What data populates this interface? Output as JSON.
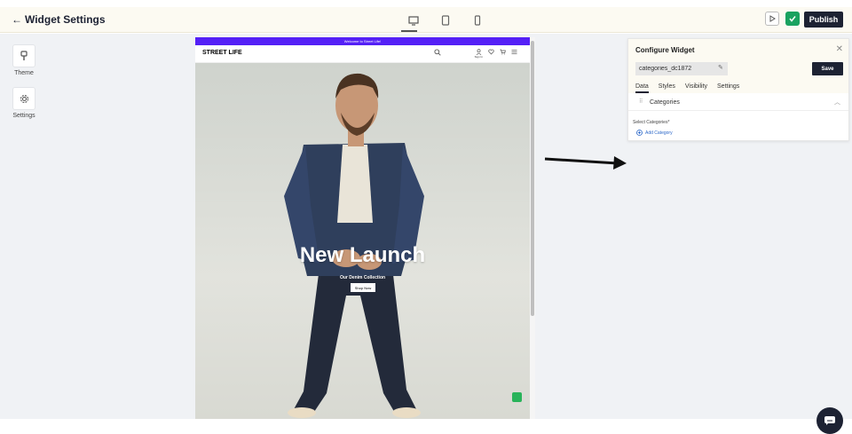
{
  "header": {
    "back_icon": "arrow-left-icon",
    "title": "Widget Settings",
    "devices": [
      {
        "name": "desktop",
        "icon": "desktop-icon",
        "active": true
      },
      {
        "name": "tablet",
        "icon": "tablet-icon",
        "active": false
      },
      {
        "name": "mobile",
        "icon": "mobile-icon",
        "active": false
      }
    ],
    "publish_label": "Publish",
    "publish_color": "#1d2233"
  },
  "sidebar": {
    "items": [
      {
        "label": "Theme",
        "icon": "brush-icon"
      },
      {
        "label": "Settings",
        "icon": "gear-icon"
      }
    ]
  },
  "preview": {
    "announcement": "Welcome to Street Life!",
    "announcement_color": "#5420f6",
    "logo": "STREET LIFE",
    "sign_in": "Sign In",
    "hero_title": "New Launch",
    "hero_subtitle": "Our Denim Collection",
    "shop_button": "Shop Now"
  },
  "panel": {
    "title": "Configure Widget",
    "widget_id": "categories_dc1872",
    "save_label": "Save",
    "tabs": [
      {
        "label": "Data",
        "active": true
      },
      {
        "label": "Styles",
        "active": false
      },
      {
        "label": "Visibility",
        "active": false
      },
      {
        "label": "Settings",
        "active": false
      }
    ],
    "section": "Categories",
    "select_label": "Select Categories*",
    "add_label": "Add Category",
    "link_color": "#2c68c9"
  }
}
